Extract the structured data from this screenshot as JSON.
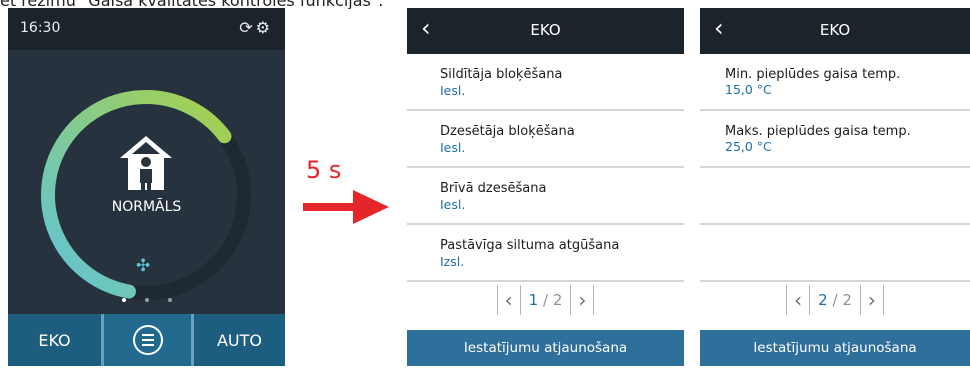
{
  "caption": "et režīmu \"Gaisa kvalitātes kontroles funkcijas\".",
  "home": {
    "time": "16:30",
    "status_icons": "⟳⚙",
    "mode_label": "NORMĀLS",
    "fan_symbol": "✣",
    "nav": {
      "left": "EKO",
      "right": "AUTO"
    },
    "ring_level_percent": 62
  },
  "transition": {
    "delay": "5 s"
  },
  "panel_a": {
    "back": "‹",
    "title": "EKO",
    "items": [
      {
        "label": "Sildītāja bloķēšana",
        "value": "Iesl."
      },
      {
        "label": "Dzesētāja bloķēšana",
        "value": "Iesl."
      },
      {
        "label": "Brīvā dzesēšana",
        "value": "Iesl."
      },
      {
        "label": "Pastāvīga siltuma atgūšana",
        "value": "Izsl."
      }
    ],
    "pager": {
      "prev": "‹",
      "current": "1",
      "sep": "/",
      "total": "2",
      "next": "›"
    },
    "reset": "Iestatījumu atjaunošana"
  },
  "panel_b": {
    "back": "‹",
    "title": "EKO",
    "items": [
      {
        "label": "Min. pieplūdes gaisa temp.",
        "value": "15,0 °C"
      },
      {
        "label": "Maks. pieplūdes gaisa temp.",
        "value": "25,0 °C"
      },
      {
        "label": "",
        "value": ""
      },
      {
        "label": "",
        "value": ""
      }
    ],
    "pager": {
      "prev": "‹",
      "current": "2",
      "sep": "/",
      "total": "2",
      "next": "›"
    },
    "reset": "Iestatījumu atjaunošana"
  },
  "colors": {
    "header_bg": "#1b232b",
    "accent_blue": "#2f6f9c",
    "value_blue": "#1f6fa3",
    "arrow_red": "#e52629",
    "ring_green": "#a8d14a",
    "ring_teal": "#5fc3d9"
  }
}
